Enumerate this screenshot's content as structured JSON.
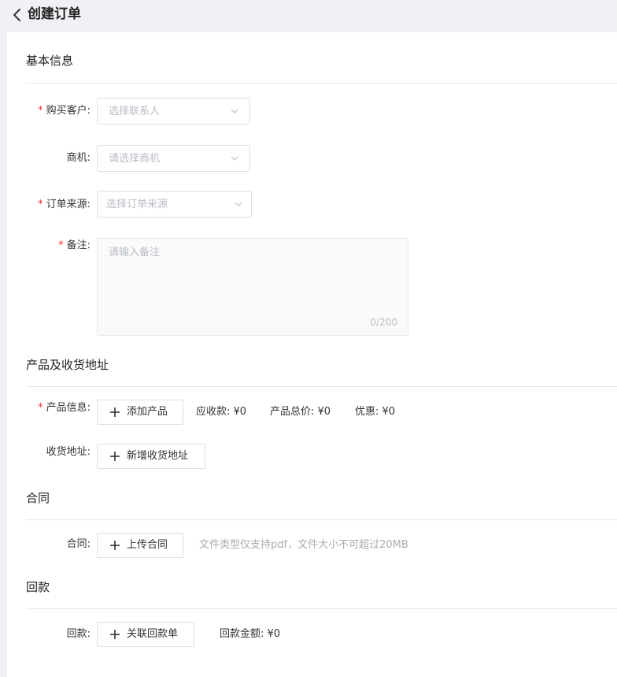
{
  "header": {
    "title": "创建订单"
  },
  "sections": {
    "basic": {
      "title": "基本信息",
      "customer": {
        "label": "购买客户:",
        "placeholder": "选择联系人"
      },
      "opportunity": {
        "label": "商机:",
        "placeholder": "请选择商机"
      },
      "source": {
        "label": "订单来源:",
        "placeholder": "选择订单来源"
      },
      "remark": {
        "label": "备注:",
        "placeholder": "请输入备注",
        "counter": "0/200"
      }
    },
    "product": {
      "title": "产品及收货地址",
      "product_info": {
        "label": "产品信息:",
        "button": "添加产品",
        "receivable": "应收款:  ¥0",
        "total": "产品总价:  ¥0",
        "discount": "优惠:  ¥0"
      },
      "address": {
        "label": "收货地址:",
        "button": "新增收货地址"
      }
    },
    "contract": {
      "title": "合同",
      "label": "合同:",
      "button": "上传合同",
      "hint": "文件类型仅支持pdf，文件大小不可超过20MB"
    },
    "payment": {
      "title": "回款",
      "label": "回款:",
      "button": "关联回款单",
      "amount": "回款金额:  ¥0"
    }
  },
  "required_marker": "*",
  "colors": {
    "required": "#f23030",
    "placeholder": "#b8bcc4",
    "border": "#dcdfe6",
    "background": "#f0f1f4"
  }
}
